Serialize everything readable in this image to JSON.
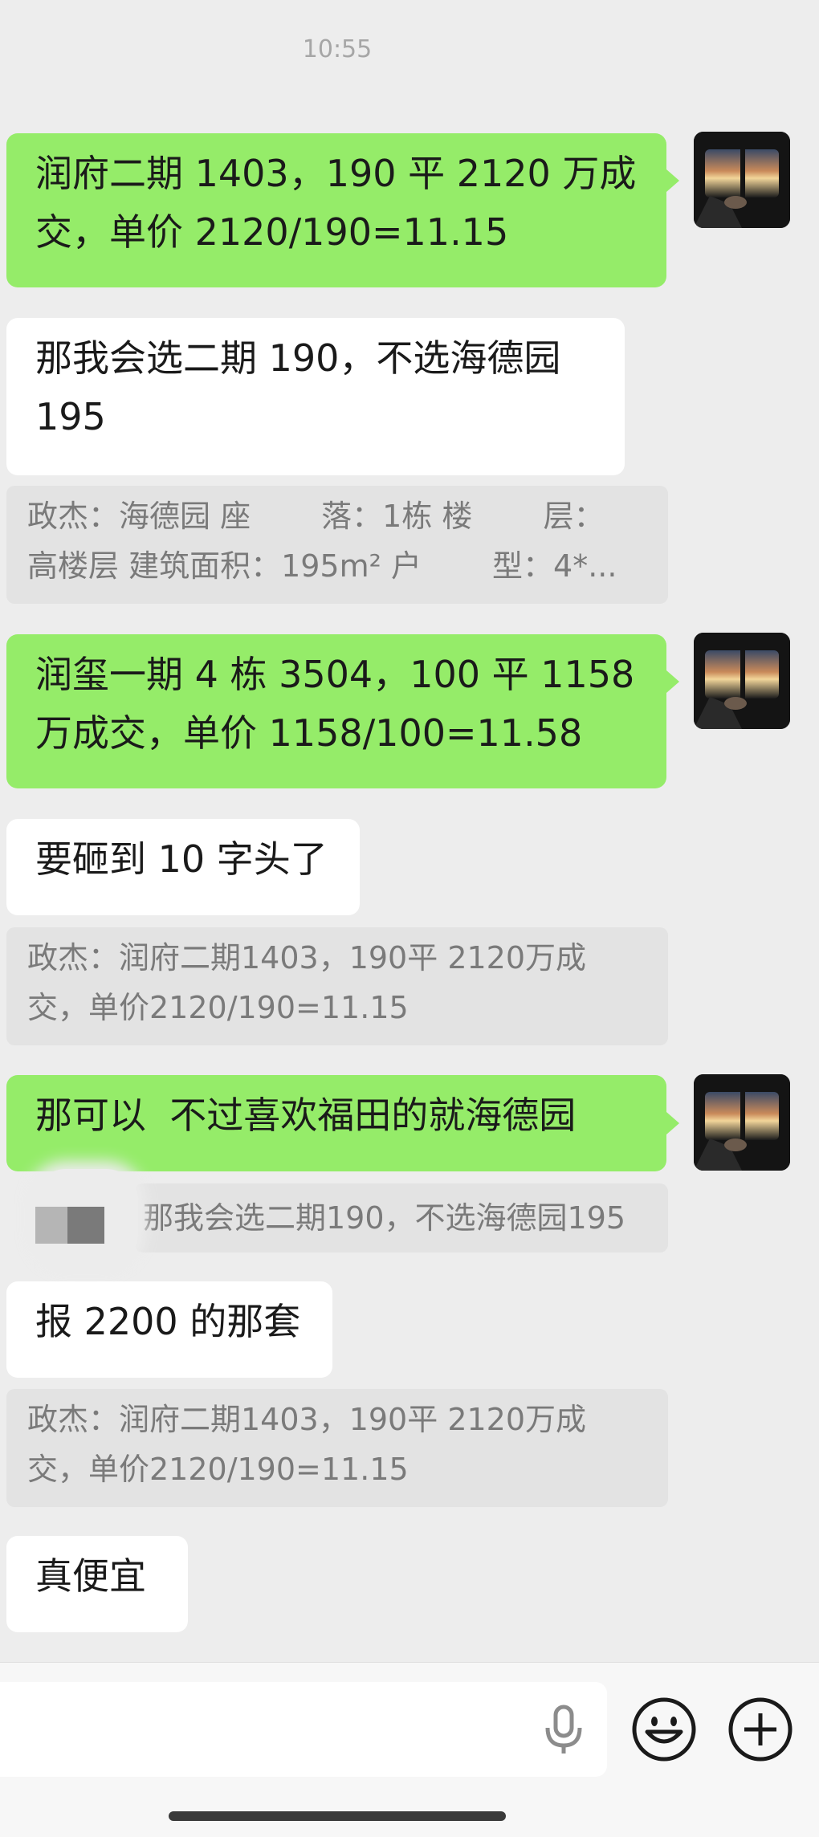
{
  "chat": {
    "timestamp": "10:55",
    "messages": [
      {
        "sender": "me",
        "text": "润府二期 1403，190 平 2120 万成\n交，单价 2120/190=11.15"
      },
      {
        "sender": "other",
        "text": "那我会选二期 190，不选海德园\n195"
      },
      {
        "sender": "quote",
        "text": "政杰：海德园 座　　 落：1栋 楼　　 层：\n高楼层 建筑面积：195m² 户　　 型：4*..."
      },
      {
        "sender": "me",
        "text": "润玺一期 4 栋 3504，100 平 1158\n万成交，单价 1158/100=11.58"
      },
      {
        "sender": "other",
        "text": "要砸到 10 字头了"
      },
      {
        "sender": "quote",
        "text": "政杰：润府二期1403，190平 2120万成\n交，单价2120/190=11.15"
      },
      {
        "sender": "me",
        "text": "那可以  不过喜欢福田的就海德园"
      },
      {
        "sender": "quote",
        "text": "那我会选二期190，不选海德园195"
      },
      {
        "sender": "other",
        "text": "报 2200 的那套"
      },
      {
        "sender": "quote",
        "text": "政杰：润府二期1403，190平 2120万成\n交，单价2120/190=11.15"
      },
      {
        "sender": "other",
        "text": "真便宜"
      }
    ]
  },
  "input_bar": {
    "voice_icon": "microphone-icon",
    "emoji_icon": "smiley-face-icon",
    "more_icon": "plus-circle-icon"
  },
  "colors": {
    "background": "#ededed",
    "sent_bubble": "#95ec69",
    "received_bubble": "#ffffff",
    "quote_block": "#e3e3e3"
  }
}
